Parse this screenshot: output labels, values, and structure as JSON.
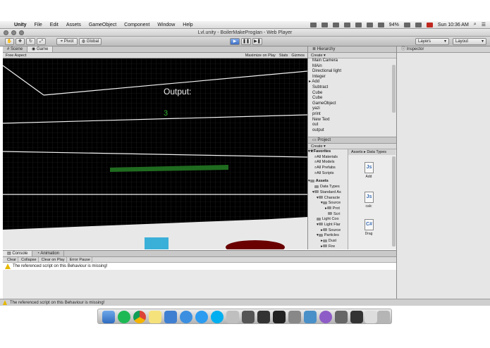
{
  "menubar": {
    "app": "Unity",
    "items": [
      "File",
      "Edit",
      "Assets",
      "GameObject",
      "Component",
      "Window",
      "Help"
    ],
    "battery": "94%",
    "clock": "Sun 10:36 AM"
  },
  "window": {
    "title": "Lvl.unity - BoilerMakeProgIan - Web Player"
  },
  "toolbar": {
    "pivot": "Pivot",
    "global": "Global",
    "layers": "Layers",
    "layout": "Layout"
  },
  "scene": {
    "tab_scene": "Scene",
    "tab_game": "Game",
    "aspect": "Free Aspect",
    "maximize": "Maximize on Play",
    "stats": "Stats",
    "gizmos": "Gizmos",
    "output_label": "Output:",
    "output_value": "3"
  },
  "hierarchy": {
    "tab": "Hierarchy",
    "create": "Create",
    "items": [
      "Main Camera",
      "MAin",
      "Directional light",
      "Integer",
      "Add",
      "Subtract",
      "Cube",
      "Cube",
      "GameObject",
      "yazi",
      "print",
      "New Text",
      "out",
      "output"
    ]
  },
  "project": {
    "tab": "Project",
    "create": "Create",
    "tree": [
      "Favorites",
      "All Materials",
      "All Models",
      "All Prefabs",
      "All Scripts",
      "Assets",
      "Data Types",
      "Standard As",
      "Characte",
      "Source",
      "Prot",
      "Scri",
      "Light Coo",
      "Light Flar",
      "Source",
      "Particles",
      "Dust",
      "Fire"
    ],
    "crumb": "Assets ▸ Data Types",
    "files": [
      {
        "glyph": "Js",
        "label": "Add"
      },
      {
        "glyph": "Js",
        "label": "calc"
      },
      {
        "glyph": "C#",
        "label": "Drag"
      }
    ]
  },
  "inspector": {
    "tab": "Inspector"
  },
  "console": {
    "tab": "Console",
    "tab2": "Animation",
    "buttons": [
      "Clear",
      "Collapse",
      "Clear on Play",
      "Error Pause"
    ],
    "message": "The referenced script on this Behaviour is missing!"
  },
  "status": {
    "message": "The referenced script on this Behaviour is missing!"
  },
  "colors": {
    "output_value": "#2ea82e",
    "progress_bar": "#1f6b1f",
    "cube": "#3ab0d8",
    "floor": "#e8e8e8"
  }
}
